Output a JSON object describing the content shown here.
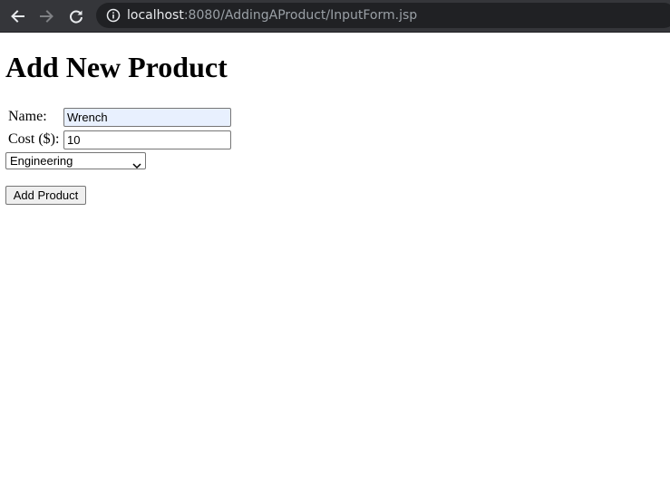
{
  "browser": {
    "url_host": "localhost",
    "url_path": ":8080/AddingAProduct/InputForm.jsp",
    "icons": [
      "back-arrow-icon",
      "forward-arrow-icon",
      "reload-icon",
      "info-icon"
    ]
  },
  "page": {
    "title": "Add New Product",
    "form": {
      "name_label": "Name:",
      "name_value": "Wrench",
      "cost_label": "Cost ($):",
      "cost_value": "10",
      "category_selected": "Engineering",
      "submit_label": "Add Product"
    }
  },
  "colors": {
    "toolbar_bg": "#35363a",
    "omnibox_bg": "#202124",
    "autofill_bg": "#e8f0fe"
  }
}
